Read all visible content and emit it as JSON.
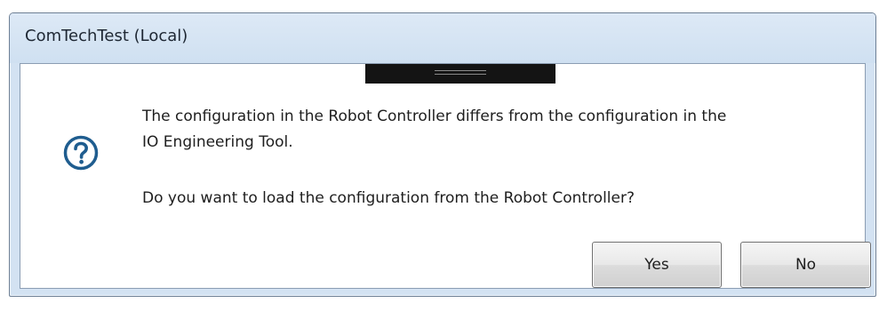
{
  "window": {
    "title": "ComTechTest (Local)"
  },
  "dialog": {
    "icon": "question-icon",
    "message_line1": "The configuration in the Robot Controller differs from the configuration in the",
    "message_line2": "IO Engineering Tool.",
    "message_line3": "Do you want to load the configuration from the Robot Controller?"
  },
  "buttons": {
    "yes_label": "Yes",
    "no_label": "No"
  },
  "colors": {
    "titlebar": "#d3e2f2",
    "icon": "#1f5d8f"
  }
}
